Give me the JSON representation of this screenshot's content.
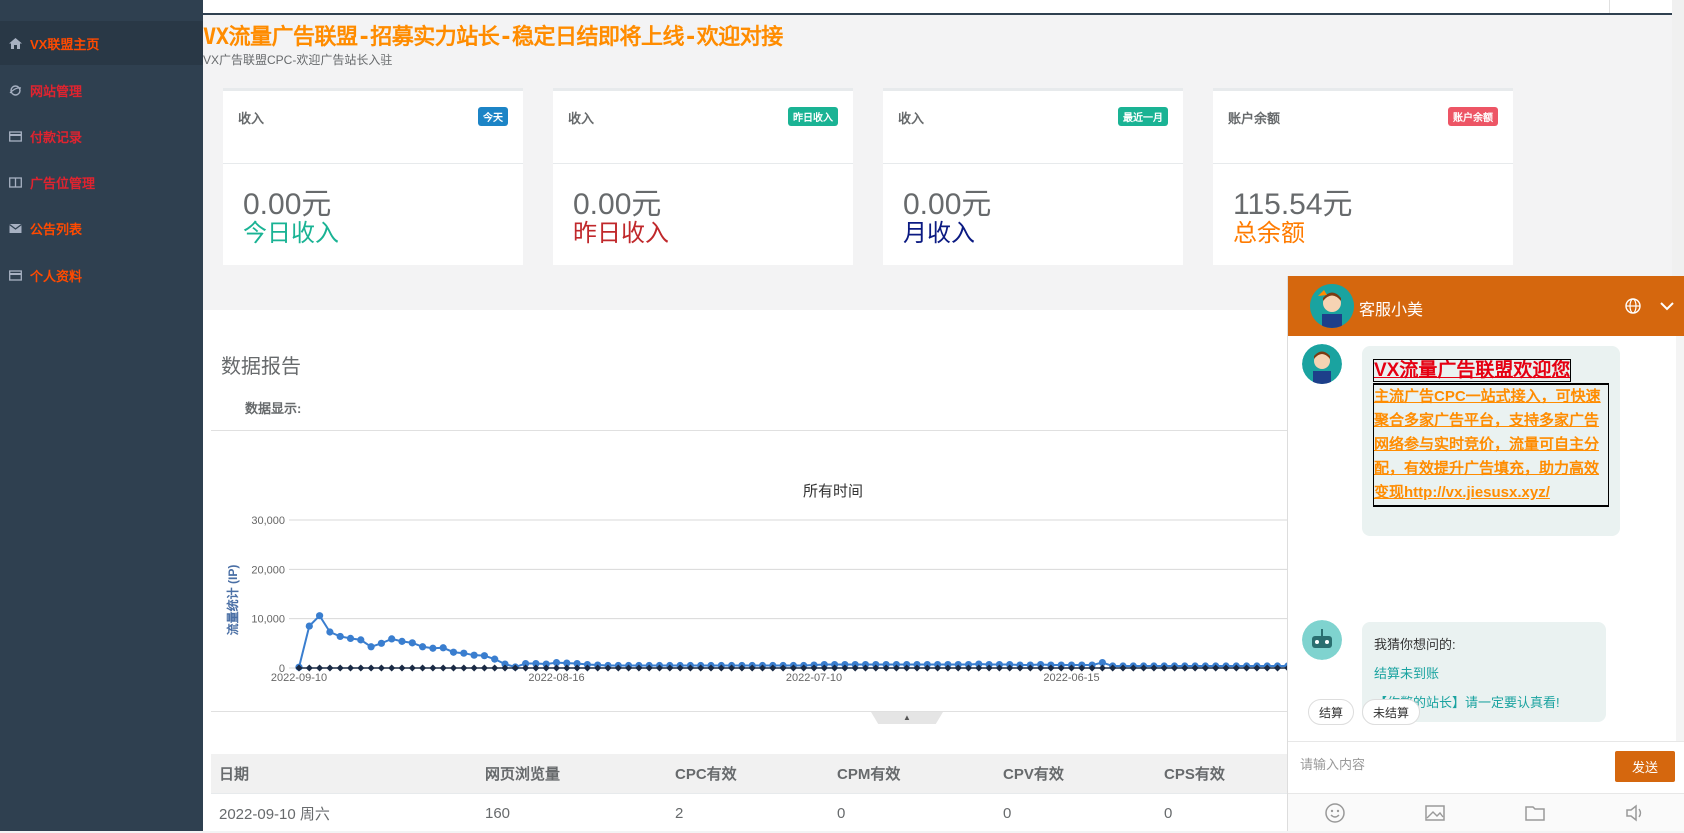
{
  "sidebar": {
    "items": [
      {
        "label": "VX联盟主页",
        "icon": "home-icon",
        "color": "#ff4a00",
        "active": true
      },
      {
        "label": "网站管理",
        "icon": "sites-icon",
        "color": "#e0232f",
        "active": false
      },
      {
        "label": "付款记录",
        "icon": "card-icon",
        "color": "#e0232f",
        "active": false
      },
      {
        "label": "广告位管理",
        "icon": "columns-icon",
        "color": "#e0232f",
        "active": false
      },
      {
        "label": "公告列表",
        "icon": "envelope-icon",
        "color": "#ff4a00",
        "active": false
      },
      {
        "label": "个人资料",
        "icon": "card-icon",
        "color": "#ff4a00",
        "active": false
      }
    ]
  },
  "header": {
    "marquee": "VX流量广告联盟-招募实力站长-稳定日结即将上线-欢迎对接",
    "subtitle": "VX广告联盟CPC-欢迎广告站长入驻"
  },
  "cards": [
    {
      "title": "收入",
      "badge": "今天",
      "badge_color": "#1c84c6",
      "value": "0.00元",
      "label": "今日收入",
      "label_color": "#1ab394"
    },
    {
      "title": "收入",
      "badge": "昨日收入",
      "badge_color": "#1ab394",
      "value": "0.00元",
      "label": "昨日收入",
      "label_color": "#c0282b"
    },
    {
      "title": "收入",
      "badge": "最近一月",
      "badge_color": "#1ab394",
      "value": "0.00元",
      "label": "月收入",
      "label_color": "#0b1a82"
    },
    {
      "title": "账户余额",
      "badge": "账户余额",
      "badge_color": "#ed5565",
      "value": "115.54元",
      "label": "总余额",
      "label_color": "#ff7b00"
    }
  ],
  "report": {
    "title": "数据报告",
    "subtitle": "数据显示:"
  },
  "chart_data": {
    "type": "line",
    "title": "所有时间",
    "ylabel": "流量统计 (IP)",
    "ylim": [
      0,
      30000
    ],
    "yticks": [
      "0",
      "10,000",
      "20,000",
      "30,000"
    ],
    "xtick_labels": [
      "2022-09-10",
      "2022-08-16",
      "2022-07-10",
      "2022-06-15"
    ],
    "series": [
      {
        "color": "#3a7ecf",
        "values": [
          160,
          8500,
          10600,
          7300,
          6400,
          6000,
          5700,
          4300,
          5000,
          5900,
          5400,
          5100,
          4300,
          4000,
          4100,
          3200,
          3000,
          2600,
          2500,
          1800,
          800,
          200,
          900,
          900,
          800,
          1100,
          1000,
          900,
          700,
          600,
          500,
          500,
          500,
          500,
          500,
          500,
          500,
          500,
          500,
          500,
          500,
          500,
          500,
          500,
          500,
          500,
          500,
          500,
          500,
          500,
          600,
          700,
          700,
          700,
          700,
          700,
          700,
          700,
          700,
          700,
          700,
          700,
          700,
          700,
          700,
          700,
          800,
          700,
          700,
          700,
          600,
          600,
          700,
          600,
          600,
          600,
          600,
          600,
          1100,
          400,
          400,
          400,
          400,
          400,
          400,
          400,
          400,
          400,
          400,
          400,
          400,
          400,
          400,
          400,
          400,
          400,
          400,
          400,
          400,
          400
        ]
      },
      {
        "color": "#1a2a44",
        "values": [
          2,
          2,
          2,
          2,
          2,
          2,
          2,
          2,
          2,
          2,
          2,
          2,
          2,
          2,
          2,
          2,
          2,
          2,
          2,
          2,
          2,
          2,
          2,
          2,
          2,
          2,
          2,
          2,
          2,
          2,
          2,
          2,
          2,
          2,
          2,
          2,
          2,
          2,
          2,
          2,
          2,
          2,
          2,
          2,
          2,
          2,
          2,
          2,
          2,
          2,
          2,
          2,
          2,
          2,
          2,
          2,
          2,
          2,
          2,
          2,
          2,
          2,
          2,
          2,
          2,
          2,
          2,
          2,
          2,
          2,
          2,
          2,
          2,
          2,
          2,
          2,
          2,
          2,
          2,
          2,
          2,
          2,
          2,
          2,
          2,
          2,
          2,
          2,
          2,
          2,
          2,
          2,
          2,
          2,
          2,
          2,
          2,
          2,
          2,
          2
        ]
      }
    ]
  },
  "table": {
    "headers": [
      "日期",
      "网页浏览量",
      "CPC有效",
      "CPM有效",
      "CPV有效",
      "CPS有效"
    ],
    "rows": [
      [
        "2022-09-10 周六",
        "160",
        "2",
        "0",
        "0",
        "0"
      ]
    ]
  },
  "chat": {
    "name": "客服小美",
    "welcome_title": "VX流量广告联盟欢迎您",
    "welcome_body": "主流广告CPC一站式接入，可快速聚合多家广告平台，支持多家广告网络参与实时竞价，流量可自主分配，有效提升广告填充，助力高效变现http://vx.jiesusx.xyz/",
    "guess_lead": "我猜你想问的:",
    "guess_links": [
      "结算未到账",
      "【作弊的站长】请一定要认真看!"
    ],
    "quick_replies": [
      "结算",
      "未结算"
    ],
    "input_placeholder": "请输入内容",
    "send_label": "发送",
    "accent": "#d5670e"
  }
}
